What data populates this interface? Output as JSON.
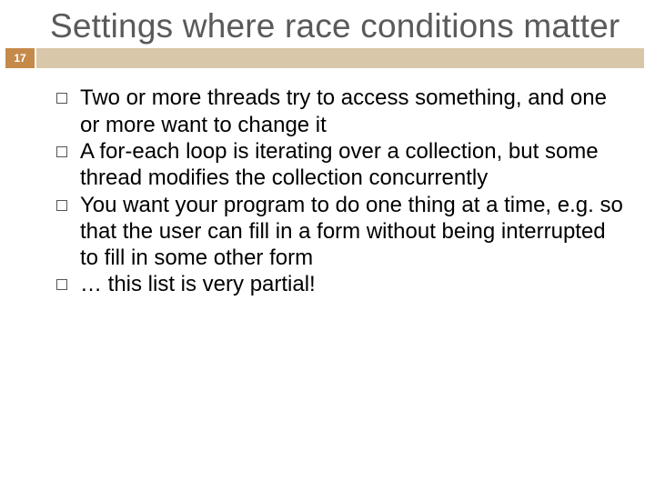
{
  "slide": {
    "number": "17",
    "title": "Settings where race conditions matter",
    "bullets": [
      "Two or more threads try to access something, and one or more want to change it",
      "A for-each loop is iterating over a collection, but some thread modifies the collection concurrently",
      "You want your program to do one thing at a time, e.g. so that the user can fill in a form without being interrupted to fill in some other form",
      "… this list is very partial!"
    ]
  }
}
